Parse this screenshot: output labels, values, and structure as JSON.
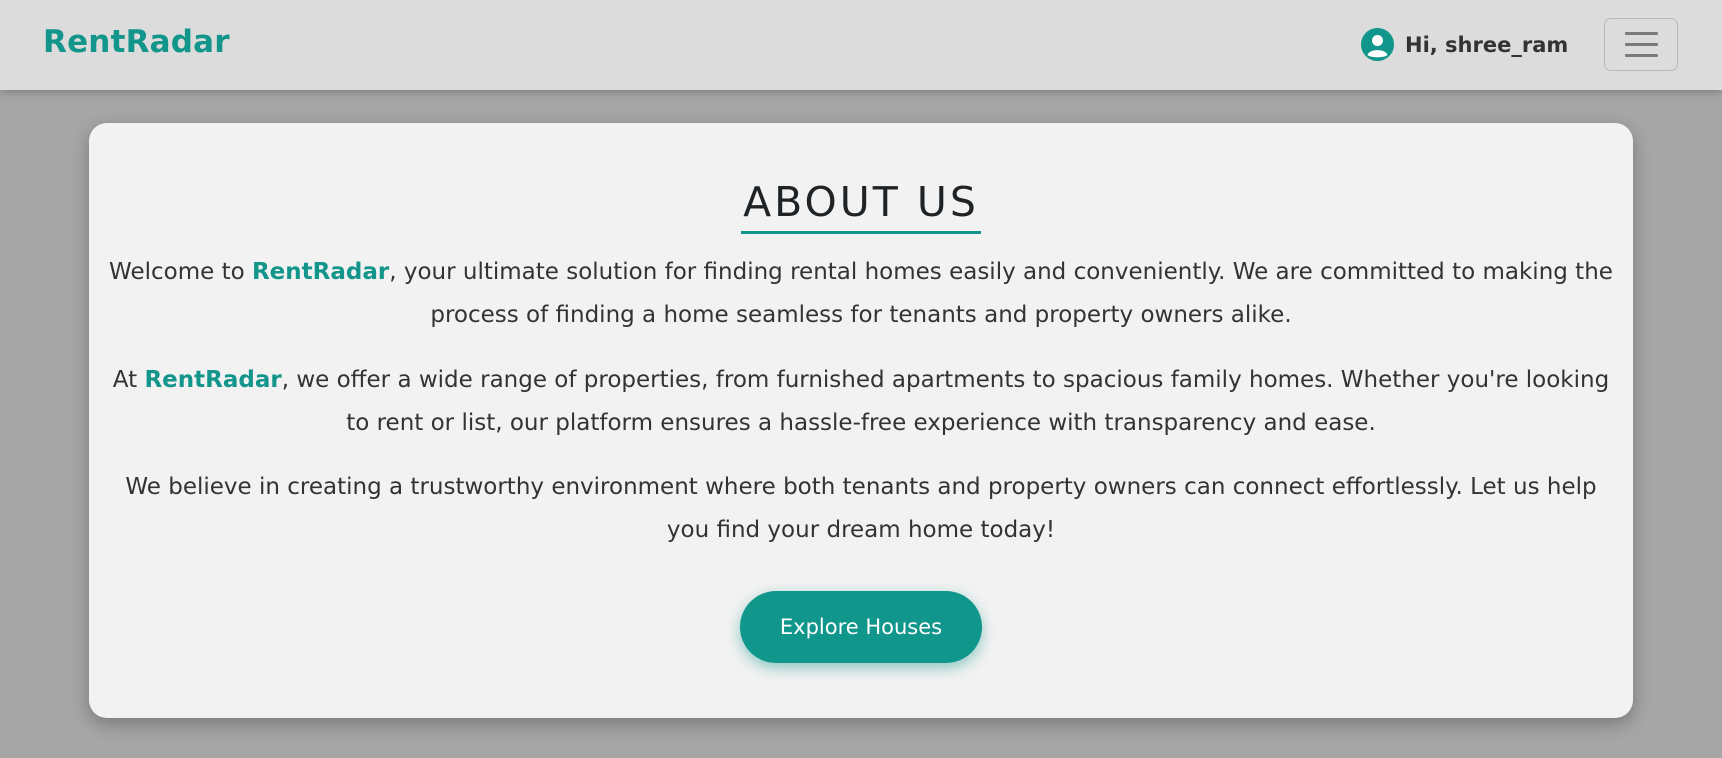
{
  "header": {
    "brand": "RentRadar",
    "greeting": "Hi, shree_ram",
    "user_icon": "user-circle-icon",
    "menu_icon": "hamburger-menu-icon"
  },
  "about": {
    "title": "ABOUT US",
    "brand_highlight": "RentRadar",
    "p1_before": "Welcome to ",
    "p1_after": ", your ultimate solution for finding rental homes easily and conveniently. We are committed to making the process of finding a home seamless for tenants and property owners alike.",
    "p2_before": "At ",
    "p2_after": ", we offer a wide range of properties, from furnished apartments to spacious family homes. Whether you're looking to rent or list, our platform ensures a hassle-free experience with transparency and ease.",
    "p3": "We believe in creating a trustworthy environment where both tenants and property owners can connect effortlessly. Let us help you find your dream home today!",
    "button_label": "Explore Houses"
  },
  "colors": {
    "accent": "#12958a",
    "navbar_bg": "#dcdcdc",
    "page_bg": "#a6a6a6",
    "card_bg": "#f2f2f2"
  }
}
